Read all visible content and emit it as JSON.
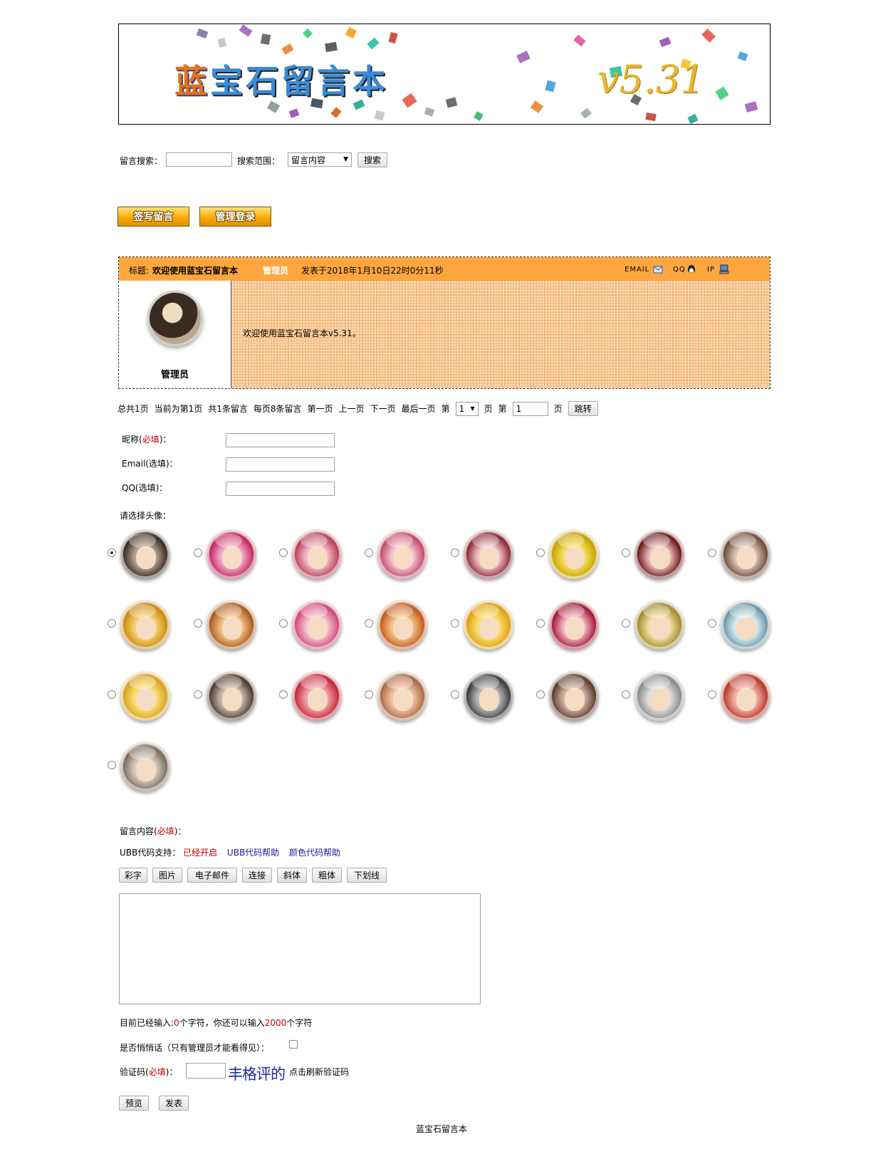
{
  "banner": {
    "title_part1": "蓝",
    "title_part2": "宝石留言本",
    "version": "v5.31"
  },
  "search": {
    "label": "留言搜索：",
    "value": "",
    "scope_label": "搜索范围：",
    "scope_selected": "留言内容",
    "button": "搜索"
  },
  "actions": {
    "sign": "签写留言",
    "admin": "管理登录"
  },
  "message": {
    "title_label": "标题:",
    "title": "欢迎使用蓝宝石留言本",
    "author": "管理员",
    "posted": "发表于2018年1月10日22时0分11秒",
    "email_label": "EMAIL",
    "qq_label": "QQ",
    "ip_label": "IP",
    "username": "管理员",
    "content": "欢迎使用蓝宝石留言本v5.31。"
  },
  "pagination": {
    "total_pages": "总共1页",
    "current": "当前为第1页",
    "total_posts": "共1条留言",
    "per_page": "每页8条留言",
    "first": "第一页",
    "prev": "上一页",
    "next": "下一页",
    "last": "最后一页",
    "di": "第",
    "page_select": "1",
    "ye": "页",
    "di2": "第",
    "jump_value": "1",
    "ye2": "页",
    "jump_button": "跳转"
  },
  "form": {
    "nickname_label": "昵称(",
    "required": "必填",
    "close": ")：",
    "email_label": "Email(选填)：",
    "qq_label": "QQ(选填)：",
    "avatar_label": "请选择头像：",
    "content_label": "留言内容(",
    "ubb_label": "UBB代码支持：",
    "ubb_status": "已经开启",
    "ubb_help": "UBB代码帮助",
    "color_help": "颜色代码帮助",
    "ubb_buttons": [
      "彩字",
      "图片",
      "电子邮件",
      "连接",
      "斜体",
      "粗体",
      "下划线"
    ],
    "count_prefix": "目前已经输入:",
    "count_value": "0",
    "count_mid": "个字符，你还可以输入",
    "count_remaining": "2000",
    "count_suffix": "个字符",
    "private_label": "是否悄悄话（只有管理员才能看得见）：",
    "captcha_label": "验证码(",
    "captcha_text": "丰格评的",
    "captcha_refresh": "点击刷新验证码",
    "preview": "预览",
    "submit": "发表"
  },
  "footer": {
    "text": "蓝宝石留言本"
  },
  "colors": {
    "header_orange": "#ffa63f",
    "body_orange": "#f7c38e",
    "required_red": "#c00000",
    "link_blue": "#1a1a9a"
  }
}
